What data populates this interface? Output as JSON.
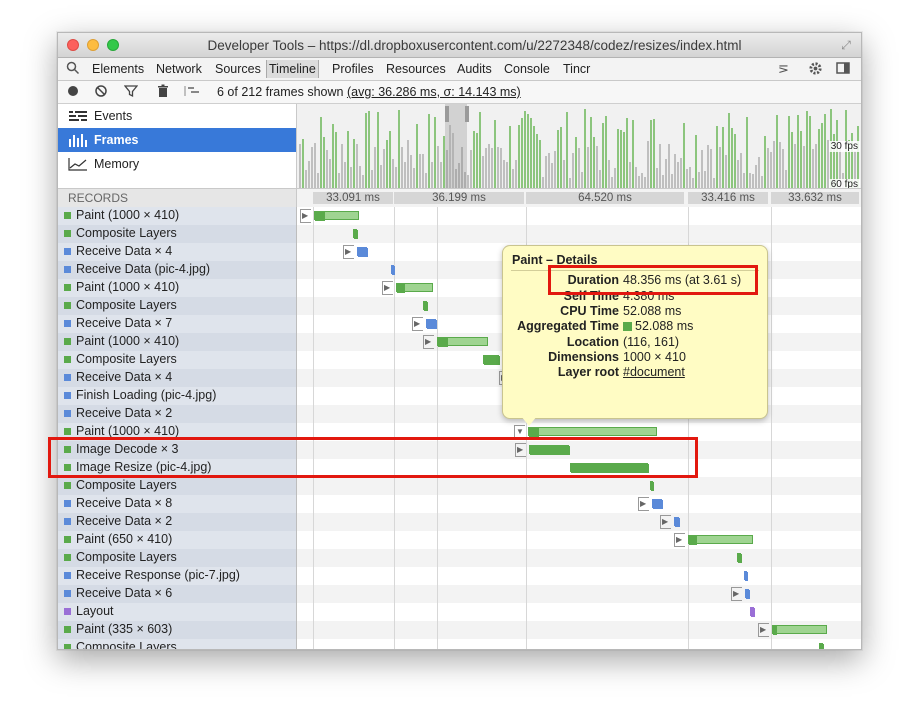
{
  "window": {
    "title": "Developer Tools – https://dl.dropboxusercontent.com/u/2272348/codez/resizes/index.html"
  },
  "tabs": [
    {
      "label": "Elements",
      "active": false
    },
    {
      "label": "Network",
      "active": false
    },
    {
      "label": "Sources",
      "active": false
    },
    {
      "label": "Timeline",
      "active": true
    },
    {
      "label": "Profiles",
      "active": false
    },
    {
      "label": "Resources",
      "active": false
    },
    {
      "label": "Audits",
      "active": false
    },
    {
      "label": "Console",
      "active": false
    },
    {
      "label": "Tincr",
      "active": false
    }
  ],
  "toolbar": {
    "frames_shown": "6 of 212 frames shown",
    "avg_stats": "(avg: 36.286 ms, σ: 14.143 ms)"
  },
  "sidebar": {
    "items": [
      {
        "label": "Events",
        "icon": "events-icon",
        "active": false
      },
      {
        "label": "Frames",
        "icon": "frames-icon",
        "active": true
      },
      {
        "label": "Memory",
        "icon": "memory-icon",
        "active": false
      }
    ],
    "records_header": "RECORDS"
  },
  "overview": {
    "fps_30": "30 fps",
    "fps_60": "60 fps"
  },
  "frame_durations": [
    "33.091 ms",
    "36.199 ms",
    "64.520 ms",
    "33.416 ms",
    "33.632 ms"
  ],
  "records": [
    {
      "label": "Paint (1000 × 410)",
      "type": "paint"
    },
    {
      "label": "Composite Layers",
      "type": "paint"
    },
    {
      "label": "Receive Data × 4",
      "type": "loading"
    },
    {
      "label": "Receive Data (pic-4.jpg)",
      "type": "loading"
    },
    {
      "label": "Paint (1000 × 410)",
      "type": "paint"
    },
    {
      "label": "Composite Layers",
      "type": "paint"
    },
    {
      "label": "Receive Data × 7",
      "type": "loading"
    },
    {
      "label": "Paint (1000 × 410)",
      "type": "paint"
    },
    {
      "label": "Composite Layers",
      "type": "paint"
    },
    {
      "label": "Receive Data × 4",
      "type": "loading"
    },
    {
      "label": "Finish Loading (pic-4.jpg)",
      "type": "loading"
    },
    {
      "label": "Receive Data × 2",
      "type": "loading"
    },
    {
      "label": "Paint (1000 × 410)",
      "type": "paint"
    },
    {
      "label": "Image Decode × 3",
      "type": "paint"
    },
    {
      "label": "Image Resize (pic-4.jpg)",
      "type": "paint"
    },
    {
      "label": "Composite Layers",
      "type": "paint"
    },
    {
      "label": "Receive Data × 8",
      "type": "loading"
    },
    {
      "label": "Receive Data × 2",
      "type": "loading"
    },
    {
      "label": "Paint (650 × 410)",
      "type": "paint"
    },
    {
      "label": "Composite Layers",
      "type": "paint"
    },
    {
      "label": "Receive Response (pic-7.jpg)",
      "type": "loading"
    },
    {
      "label": "Receive Data × 6",
      "type": "loading"
    },
    {
      "label": "Layout",
      "type": "rendering"
    },
    {
      "label": "Paint (335 × 603)",
      "type": "paint"
    },
    {
      "label": "Composite Layers",
      "type": "paint"
    }
  ],
  "colors": {
    "paint": "#5aaa4b",
    "paint_light": "#9fd491",
    "loading": "#5b8ad9",
    "rendering": "#9a6fd6",
    "highlight": "#e2180f",
    "popover_bg": "#fffcc4",
    "selected": "#3879d9"
  },
  "popover": {
    "title": "Paint – Details",
    "rows": [
      {
        "key": "Duration",
        "value": "48.356 ms (at 3.61 s)"
      },
      {
        "key": "Self Time",
        "value": "4.380 ms"
      },
      {
        "key": "CPU Time",
        "value": "52.088 ms"
      },
      {
        "key": "Aggregated Time",
        "value": "52.088 ms"
      },
      {
        "key": "Location",
        "value": "(116, 161)"
      },
      {
        "key": "Dimensions",
        "value": "1000 × 410"
      },
      {
        "key": "Layer root",
        "value": "#document"
      }
    ]
  }
}
